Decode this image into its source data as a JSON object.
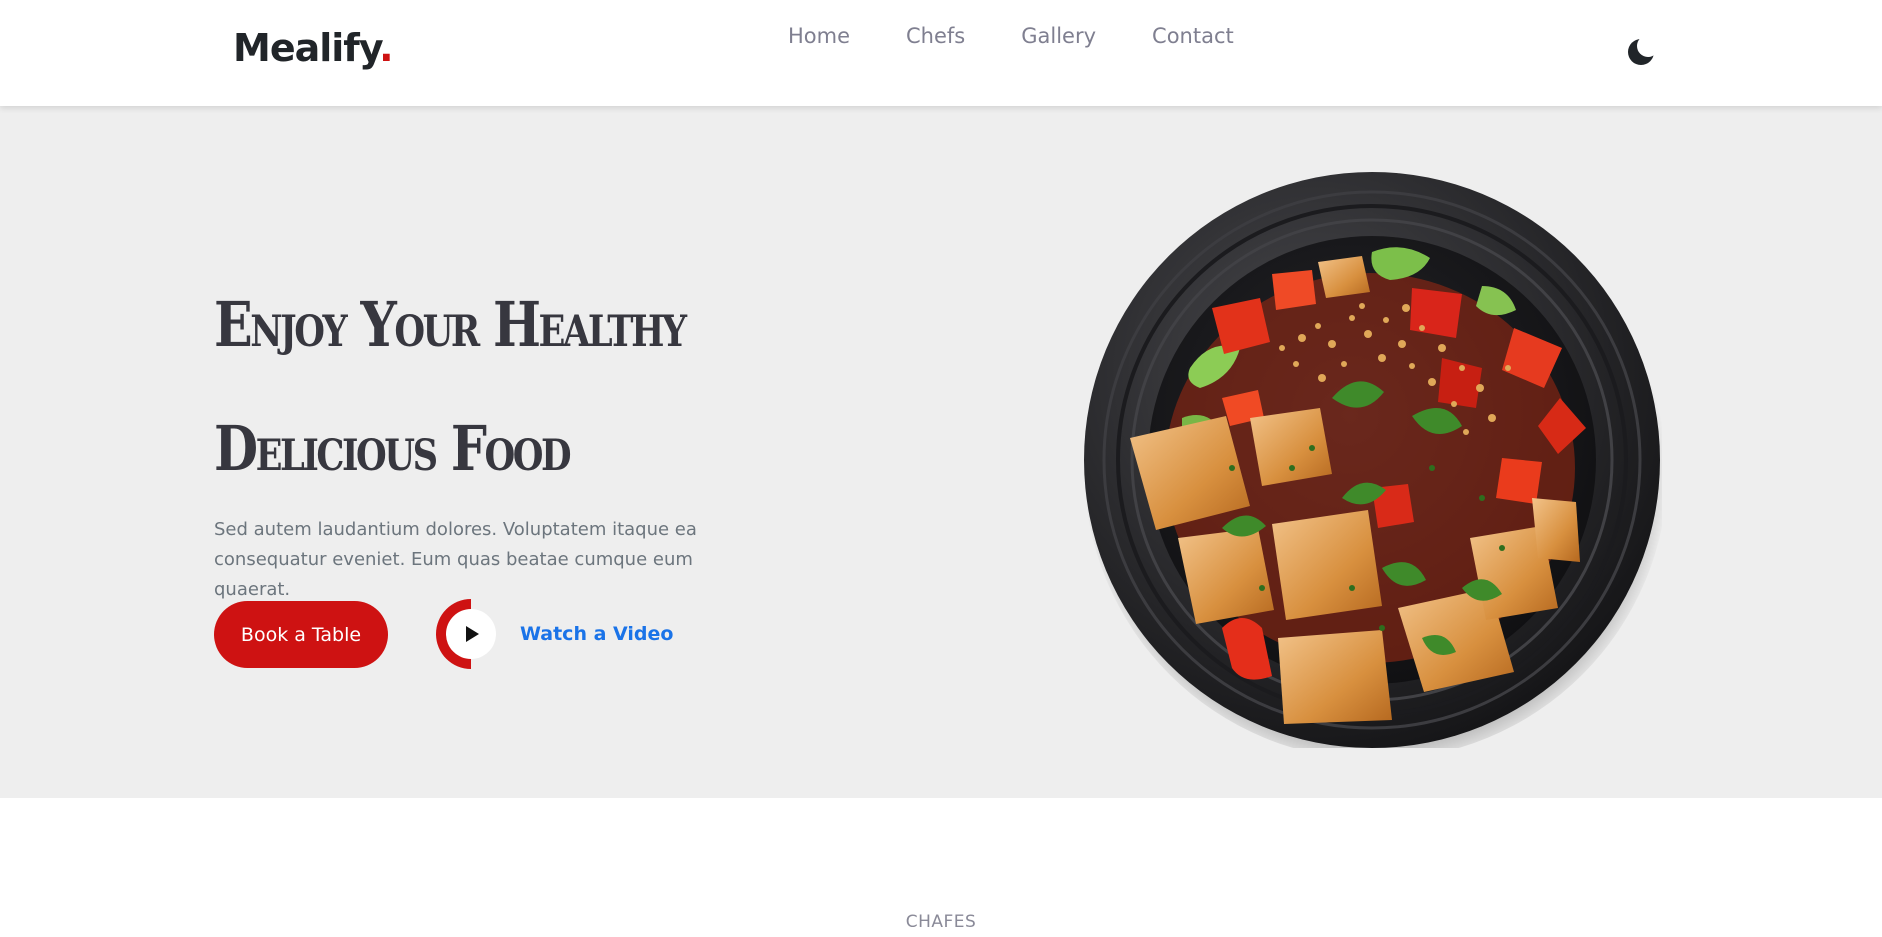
{
  "header": {
    "logo_text": "Mealify",
    "logo_dot": ".",
    "nav": [
      "Home",
      "Chefs",
      "Gallery",
      "Contact"
    ],
    "theme_icon": "moon-icon"
  },
  "hero": {
    "title_line1": "Enjoy Your Healthy",
    "title_line2": "Delicious Food",
    "description": "Sed autem laudantium dolores. Voluptatem itaque ea consequatur eveniet. Eum quas beatae cumque eum quaerat.",
    "book_button": "Book a Table",
    "video_button": "Watch a Video",
    "image_subject": "plate-of-food"
  },
  "next_section": {
    "label": "CHAFES"
  },
  "colors": {
    "accent": "#ce1212",
    "link": "#1a73e8",
    "hero_bg": "#eeeeee",
    "text_dark": "#37373f",
    "text_muted": "#6c757d"
  }
}
